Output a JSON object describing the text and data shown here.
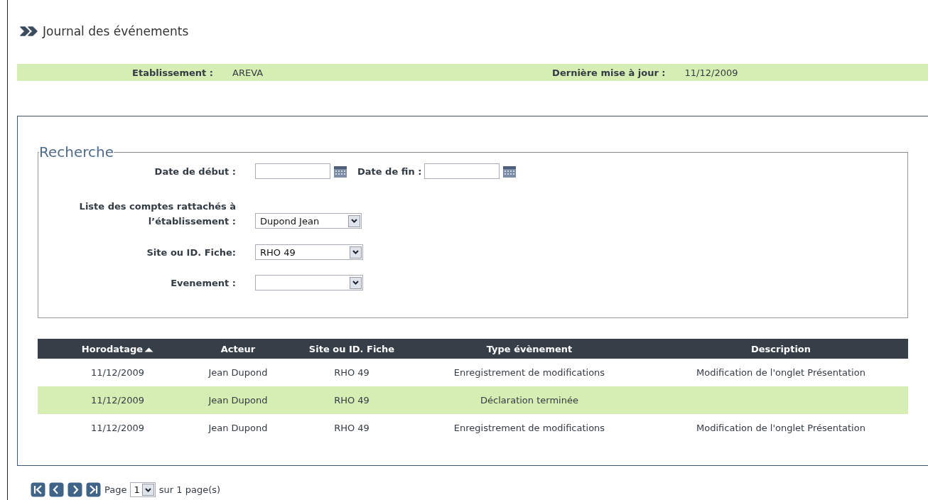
{
  "title": "Journal des événements",
  "info_bar": [
    {
      "label": "Etablissement :",
      "value": "AREVA"
    },
    {
      "label": "Dernière mise à jour :",
      "value": "11/12/2009"
    }
  ],
  "search": {
    "legend": "Recherche",
    "date_start": {
      "label": "Date de début :"
    },
    "date_end": {
      "label": "Date de fin :"
    },
    "fields": [
      {
        "label_lines": [
          "Liste des comptes rattachés à",
          "l’établissement :"
        ],
        "value": "Dupond Jean"
      },
      {
        "label_lines": [
          "Site ou ID. Fiche:"
        ],
        "value": "RHO 49"
      },
      {
        "label_lines": [
          "Evenement :"
        ]
      }
    ]
  },
  "table": {
    "columns": [
      {
        "label": "Horodatage",
        "sorted": true
      },
      {
        "label": "Acteur",
        "sorted": false
      },
      {
        "label": "Site ou ID. Fiche",
        "sorted": false
      },
      {
        "label": "Type évènement",
        "sorted": false
      },
      {
        "label": "Description",
        "sorted": false
      }
    ],
    "rows": [
      [
        "11/12/2009",
        "Jean Dupond",
        "RHO 49",
        "Enregistrement de modifications",
        "Modification de l'onglet Présentation"
      ],
      [
        "11/12/2009",
        "Jean Dupond",
        "RHO 49",
        "Déclaration terminée",
        ""
      ],
      [
        "11/12/2009",
        "Jean Dupond",
        "RHO 49",
        "Enregistrement de modifications",
        "Modification de l'onglet Présentation"
      ]
    ]
  },
  "pager": {
    "label": "Page",
    "page": "1",
    "suffix": "sur 1 page(s)"
  }
}
